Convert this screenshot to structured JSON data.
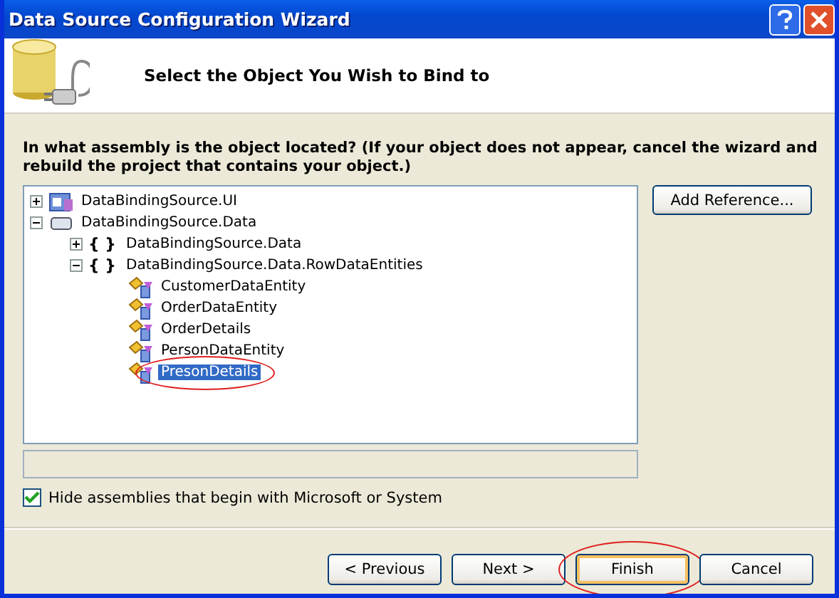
{
  "window": {
    "title": "Data Source Configuration Wizard"
  },
  "header": {
    "title": "Select the Object You Wish to Bind to"
  },
  "prompt": "In what assembly is the object located? (If your object does not appear, cancel the wizard and rebuild the project that contains your object.)",
  "tree": [
    {
      "label": "DataBindingSource.UI",
      "kind": "project",
      "expanded": false,
      "selected": false
    },
    {
      "label": "DataBindingSource.Data",
      "kind": "assembly",
      "expanded": true,
      "selected": false,
      "children": [
        {
          "label": "DataBindingSource.Data",
          "kind": "namespace",
          "icon_text": "{ }",
          "expanded": false,
          "selected": false
        },
        {
          "label": "DataBindingSource.Data.RowDataEntities",
          "kind": "namespace",
          "icon_text": "{ }",
          "expanded": true,
          "selected": false,
          "children": [
            {
              "label": "CustomerDataEntity",
              "kind": "class",
              "selected": false
            },
            {
              "label": "OrderDataEntity",
              "kind": "class",
              "selected": false
            },
            {
              "label": "OrderDetails",
              "kind": "class",
              "selected": false
            },
            {
              "label": "PersonDataEntity",
              "kind": "class",
              "selected": false
            },
            {
              "label": "PresonDetails",
              "kind": "class",
              "selected": true,
              "circled": true
            }
          ]
        }
      ]
    }
  ],
  "add_reference_button": "Add Reference...",
  "hide_assemblies": {
    "label": "Hide assemblies that begin with Microsoft or System",
    "checked": true
  },
  "buttons": [
    {
      "label": "< Previous",
      "default": false,
      "circled": false
    },
    {
      "label": "Next >",
      "default": false,
      "circled": false
    },
    {
      "label": "Finish",
      "default": true,
      "circled": true
    },
    {
      "label": "Cancel",
      "default": false,
      "circled": false
    }
  ]
}
